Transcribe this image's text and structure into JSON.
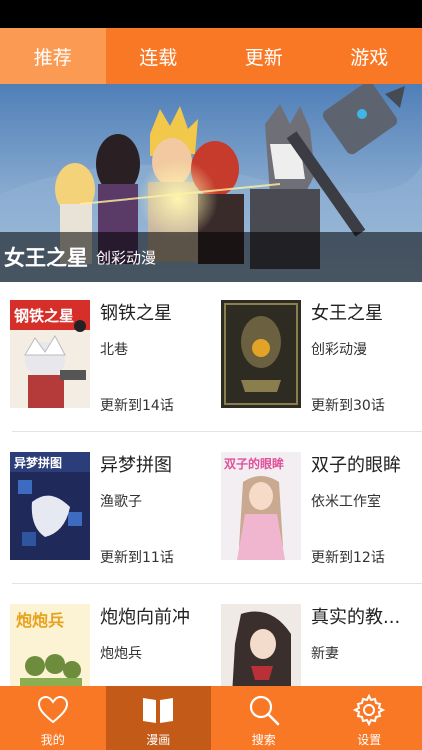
{
  "tabs": [
    {
      "label": "推荐",
      "active": true
    },
    {
      "label": "连载",
      "active": false
    },
    {
      "label": "更新",
      "active": false
    },
    {
      "label": "游戏",
      "active": false
    }
  ],
  "banner": {
    "title": "女王之星",
    "author": "创彩动漫"
  },
  "comics": [
    {
      "title": "钢铁之星",
      "author": "北巷",
      "update": "更新到14话"
    },
    {
      "title": "女王之星",
      "author": "创彩动漫",
      "update": "更新到30话"
    },
    {
      "title": "异梦拼图",
      "author": "渔歌子",
      "update": "更新到11话"
    },
    {
      "title": "双子的眼眸",
      "author": "依米工作室",
      "update": "更新到12话"
    },
    {
      "title": "炮炮向前冲",
      "author": "炮炮兵",
      "update": ""
    },
    {
      "title": "真实的教...",
      "author": "新妻",
      "update": ""
    }
  ],
  "cover_text": {
    "c0": "钢铁之星",
    "c2": "异梦拼图",
    "c3": "双子的眼眸",
    "c4": "炮炮兵"
  },
  "bottom_nav": [
    {
      "label": "我的",
      "icon": "heart-icon",
      "active": false
    },
    {
      "label": "漫画",
      "icon": "book-icon",
      "active": true
    },
    {
      "label": "搜索",
      "icon": "search-icon",
      "active": false
    },
    {
      "label": "设置",
      "icon": "gear-icon",
      "active": false
    }
  ],
  "colors": {
    "accent": "#f97826",
    "tab_active": "#fb9a52",
    "nav_active": "#c35a17"
  }
}
